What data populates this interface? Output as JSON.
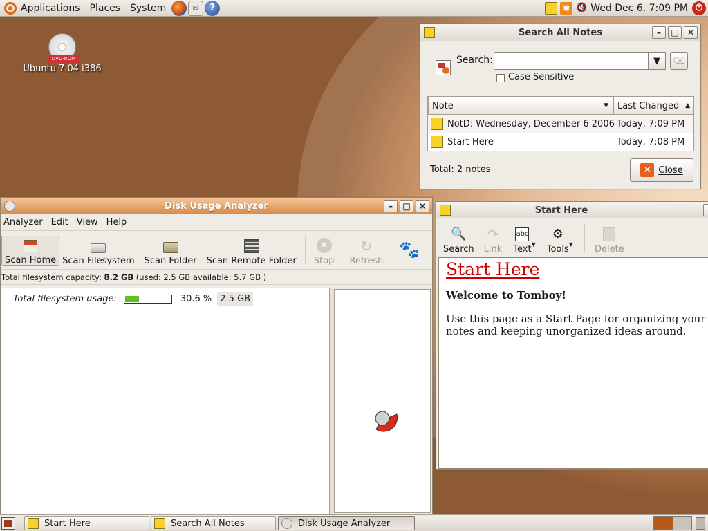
{
  "top_panel": {
    "menus": [
      "Applications",
      "Places",
      "System"
    ],
    "launchers": [
      "firefox-icon",
      "mail-icon",
      "help-icon"
    ],
    "clock": "Wed Dec  6,  7:09 PM"
  },
  "desktop": {
    "icon_badge": "DVD-ROM",
    "icon_label": "Ubuntu 7.04 i386"
  },
  "search_notes": {
    "title": "Search All Notes",
    "search_label": "Search:",
    "search_value": "",
    "case_label": "Case Sensitive",
    "columns": [
      "Note",
      "Last Changed"
    ],
    "rows": [
      {
        "note": "NotD: Wednesday, December 6 2006",
        "changed": "Today, 7:09 PM"
      },
      {
        "note": "Start Here",
        "changed": "Today, 7:08 PM"
      }
    ],
    "total": "Total: 2 notes",
    "close_label": "Close"
  },
  "disk_usage": {
    "title": "Disk Usage Analyzer",
    "menus": [
      "Analyzer",
      "Edit",
      "View",
      "Help"
    ],
    "tools": [
      "Scan Home",
      "Scan Filesystem",
      "Scan Folder",
      "Scan Remote Folder",
      "Stop",
      "Refresh"
    ],
    "capacity_prefix": "Total filesystem capacity: ",
    "capacity_value": "8.2 GB",
    "capacity_suffix": " (used: 2.5 GB available: 5.7 GB )",
    "usage_label": "Total filesystem usage:",
    "usage_percent": "30.6 %",
    "usage_fraction": 0.306,
    "usage_size": "2.5 GB"
  },
  "start_here": {
    "title": "Start Here",
    "tools": [
      "Search",
      "Link",
      "Text",
      "Tools",
      "Delete"
    ],
    "heading": "Start Here",
    "welcome": "Welcome to Tomboy!",
    "body": "Use this page as a Start Page for organizing your notes and keeping unorganized ideas around."
  },
  "taskbar": {
    "tasks": [
      "Start Here",
      "Search All Notes",
      "Disk Usage Analyzer"
    ]
  },
  "colors": {
    "accent": "#dd6a16",
    "link_red": "#cc0000",
    "usage_green": "#5fc31f"
  }
}
